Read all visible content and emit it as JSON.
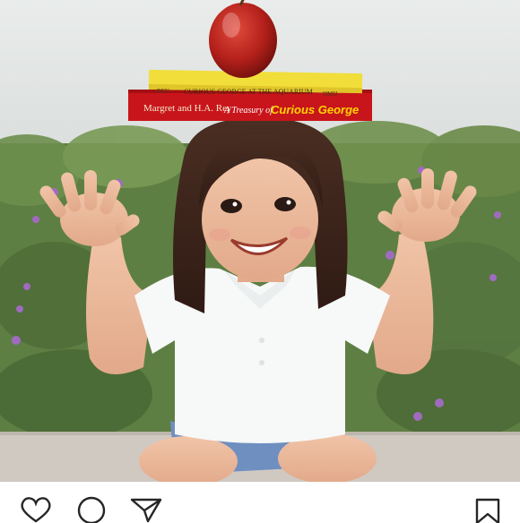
{
  "post": {
    "photo": {
      "book_top_title": "CURIOUS GEORGE AT THE AQUARIUM",
      "book_top_spine_left": "REY",
      "book_top_spine_right": "HMH",
      "book_bottom_authors": "Margret and H.A. Rey",
      "book_bottom_title_prefix": "A Treasury of",
      "book_bottom_title": "Curious George"
    },
    "actions": {
      "like_icon": "heart-icon",
      "comment_icon": "comment-bubble-icon",
      "share_icon": "paper-plane-icon",
      "save_icon": "bookmark-icon"
    },
    "colors": {
      "background": "#ffffff",
      "icon_stroke": "#262626"
    }
  }
}
